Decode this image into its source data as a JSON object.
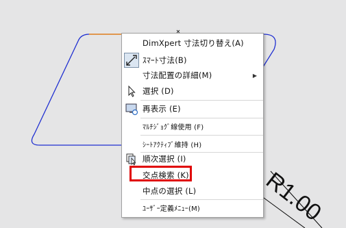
{
  "drawing": {
    "dimension_text": "R1.00"
  },
  "context_menu": {
    "items": [
      {
        "label": "DimXpert 寸法切り替え(A)"
      },
      {
        "label": "ｽﾏｰﾄ寸法(B)"
      },
      {
        "label": "寸法配置の詳細(M)",
        "has_submenu": true
      },
      {
        "label": "選択 (D)"
      },
      {
        "label": "再表示 (E)"
      },
      {
        "label": "ﾏﾙﾁｼﾞｮｸﾞ線使用 (F)"
      },
      {
        "label": "ｼｰﾄｱｸﾃｨﾌﾞ維持 (H)"
      },
      {
        "label": "順次選択 (I)"
      },
      {
        "label": "交点検索 (K)",
        "highlighted": true
      },
      {
        "label": "中点の選択 (L)"
      },
      {
        "label": "ﾕｰｻﾞｰ定義ﾒﾆｭｰ(M)"
      }
    ],
    "highlight_color": "#e00000"
  },
  "colors": {
    "background": "#e5e5e6",
    "sketch_line": "#1f2fd1",
    "selected_edge": "#f08c1c"
  }
}
